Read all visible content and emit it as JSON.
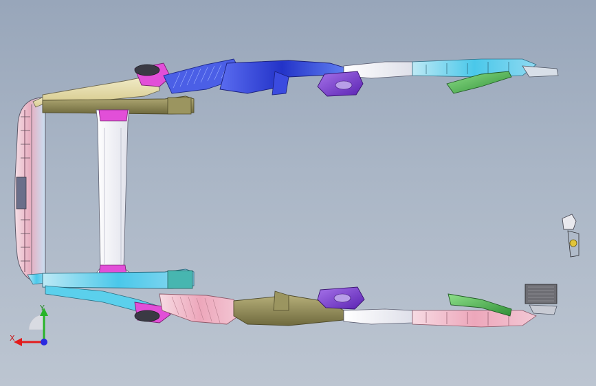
{
  "viewport": {
    "background_top": "#98a6ba",
    "background_bottom": "#bcc5d1"
  },
  "model": {
    "name": "",
    "colors": {
      "tan": "#e8dfb0",
      "olive": "#8a8550",
      "magenta": "#e24fd8",
      "pink": "#f2b7c7",
      "blue": "#2f3fd8",
      "cyan": "#3fc6e8",
      "teal": "#47b6b0",
      "purple": "#7a3ccf",
      "green": "#3fb24a",
      "white": "#f3f3f7",
      "grey": "#6d6d73"
    }
  },
  "triad": {
    "x_label": "X",
    "y_label": "Y",
    "icon": "coordinate-triad-icon",
    "x_color": "#e31b1b",
    "y_color": "#27b427",
    "z_color": "#2a2ae0"
  }
}
